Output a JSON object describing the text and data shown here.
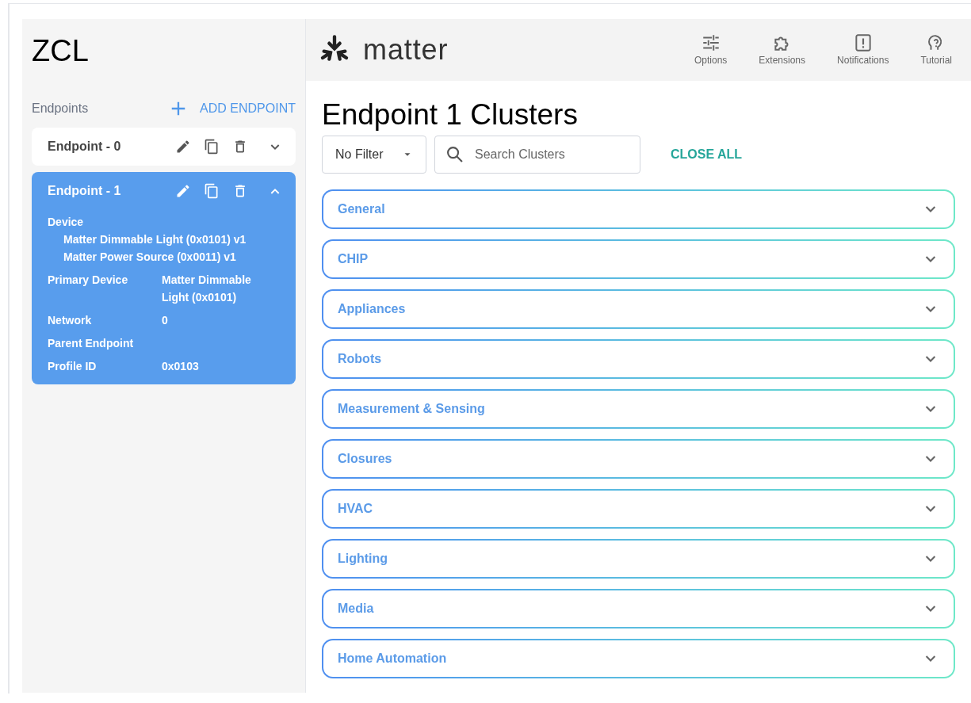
{
  "sidebar": {
    "title": "ZCL",
    "endpoints_label": "Endpoints",
    "add_button": "ADD ENDPOINT",
    "endpoints": [
      {
        "title": "Endpoint - 0",
        "selected": false,
        "expanded": false
      },
      {
        "title": "Endpoint - 1",
        "selected": true,
        "expanded": true,
        "device_label": "Device",
        "devices": [
          "Matter Dimmable Light (0x0101) v1",
          "Matter Power Source (0x0011) v1"
        ],
        "fields": [
          {
            "label": "Primary Device",
            "value": "Matter Dimmable Light (0x0101)"
          },
          {
            "label": "Network",
            "value": "0"
          },
          {
            "label": "Parent Endpoint"
          },
          {
            "label": "Profile ID",
            "value": "0x0103"
          }
        ]
      }
    ]
  },
  "header": {
    "logo": "matter",
    "actions": [
      {
        "kind": "options",
        "label": "Options"
      },
      {
        "kind": "extensions",
        "label": "Extensions"
      },
      {
        "kind": "notifications",
        "label": "Notifications"
      },
      {
        "kind": "tutorial",
        "label": "Tutorial"
      }
    ]
  },
  "main": {
    "title": "Endpoint 1 Clusters",
    "filter": "No Filter",
    "search": {
      "placeholder": "Search Clusters"
    },
    "close_all": "CLOSE ALL",
    "categories": [
      {
        "label": "General",
        "expanded": false
      },
      {
        "label": "CHIP",
        "expanded": false
      },
      {
        "label": "Appliances",
        "expanded": false
      },
      {
        "label": "Robots",
        "expanded": false
      },
      {
        "label": "Measurement & Sensing",
        "expanded": false
      },
      {
        "label": "Closures",
        "expanded": false
      },
      {
        "label": "HVAC",
        "expanded": false
      },
      {
        "label": "Lighting",
        "expanded": false
      },
      {
        "label": "Media",
        "expanded": false
      },
      {
        "label": "Home Automation",
        "expanded": false
      }
    ]
  }
}
